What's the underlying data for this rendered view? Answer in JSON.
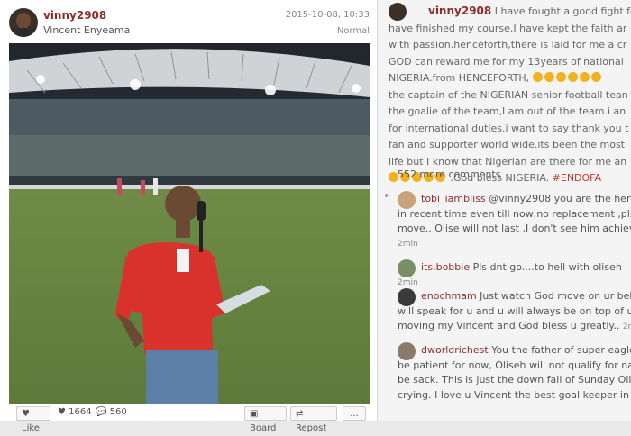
{
  "post": {
    "username": "vinny2908",
    "full_name": "Vincent Enyeama",
    "timestamp": "2015-10-08, 10:33",
    "filter": "Normal",
    "actions": {
      "like_label": "Like",
      "likes_count": "1664",
      "comments_count": "560",
      "board_label": "Board",
      "repost_label": "Repost",
      "more_label": "..."
    }
  },
  "caption": {
    "username": "vinny2908",
    "lines": [
      "I have fought a good fight for m",
      "have finished my course,I have kept the faith ar",
      "with passion.henceforth,there is laid for me a cr",
      "GOD can reward me for my 13years of national",
      "NIGERIA.from HENCEFORTH,",
      "the captain of the NIGERIAN senior football tean",
      "the goalie of the team,I am out of the team.i an",
      "for international duties.i want to say thank you t",
      "fan and supporter world wide.its been the most",
      "life but I know that Nigerian are there for me an",
      ".God bless NIGERIA."
    ],
    "hashtag": "#ENDOFA"
  },
  "more_comments": "552 more comments",
  "comments": [
    {
      "user": "tobi_iambliss",
      "lines": [
        "@vinny2908 you are the hero",
        "in recent time even till now,no replacement ,pls",
        "move.. Olise will not last ,I don't see him achiev"
      ],
      "time": "2min"
    },
    {
      "user": "its.bobbie",
      "lines": [
        "Pls dnt go....to hell with oliseh"
      ],
      "time": "2min"
    },
    {
      "user": "enochmam",
      "lines": [
        "Just watch God move on ur beh",
        "will speak for u and u will always be on top of u",
        "moving my Vincent and God bless u greatly.."
      ],
      "time": "2m"
    },
    {
      "user": "dworldrichest",
      "lines": [
        "You the father of super eagle",
        "be patient for now, Oliseh will not qualify for nat",
        "be sack. This is just the down fall of Sunday Olis",
        "crying. I love u Vincent the best goal keeper in t"
      ],
      "time": ""
    }
  ]
}
